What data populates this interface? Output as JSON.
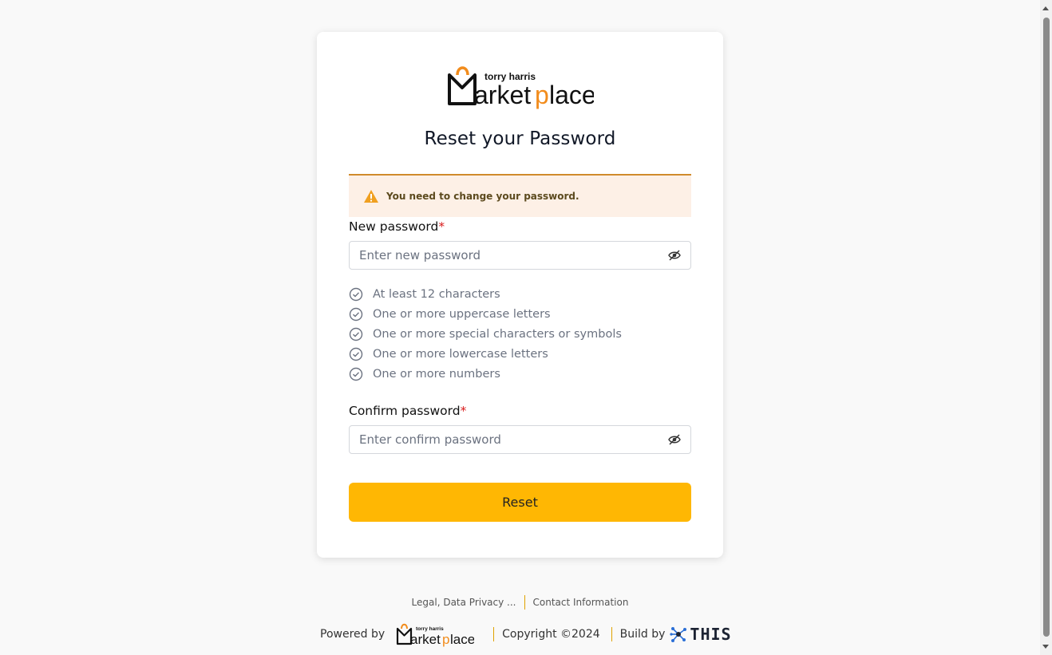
{
  "brand": {
    "logo_small_text": "torry harris",
    "logo_main_text": "Marketplace"
  },
  "page": {
    "title": "Reset your Password"
  },
  "alert": {
    "icon": "warning-icon",
    "message": "You need to change your password."
  },
  "new_password": {
    "label": "New password",
    "required_mark": "*",
    "placeholder": "Enter new password",
    "value": "",
    "toggle_icon": "eye-slash-icon"
  },
  "password_rules": [
    "At least 12 characters",
    "One or more uppercase letters",
    "One or more special characters or symbols",
    "One or more lowercase letters",
    "One or more numbers"
  ],
  "confirm_password": {
    "label": "Confirm password",
    "required_mark": "*",
    "placeholder": "Enter confirm password",
    "value": "",
    "toggle_icon": "eye-slash-icon"
  },
  "reset_button": {
    "label": "Reset"
  },
  "footer": {
    "links": [
      "Legal, Data Privacy ...",
      "Contact Information"
    ],
    "powered_by_label": "Powered by",
    "copyright": "Copyright ©2024",
    "build_by_label": "Build by",
    "build_by_brand": "THIS"
  },
  "colors": {
    "accent": "#ffb703",
    "alert_bg": "#fdf0e6",
    "alert_border": "#d08a2c",
    "logo_orange": "#f28c1c",
    "required": "#d81b1b"
  }
}
